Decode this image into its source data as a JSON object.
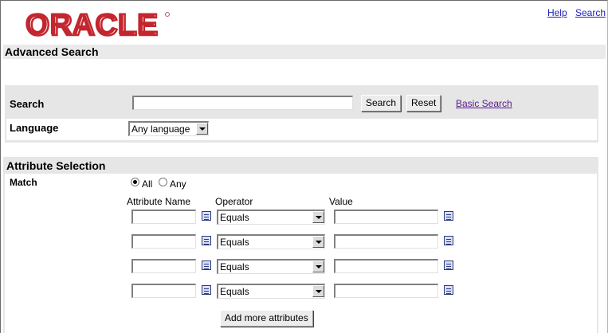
{
  "brand": {
    "logo_text": "ORACLE",
    "color": "#c4262e"
  },
  "top_links": {
    "help": "Help",
    "search": "Search"
  },
  "page_title": "Advanced Search",
  "search_panel": {
    "search_label": "Search",
    "search_value": "",
    "search_button": "Search",
    "reset_button": "Reset",
    "basic_search_link": "Basic Search",
    "language_label": "Language",
    "language_value": "Any language"
  },
  "attributes": {
    "title": "Attribute Selection",
    "match_label": "Match",
    "match_options": [
      {
        "label": "All",
        "selected": true
      },
      {
        "label": "Any",
        "selected": false
      }
    ],
    "columns": [
      "Attribute Name",
      "Operator",
      "Value"
    ],
    "rows": [
      {
        "name": "",
        "operator": "Equals",
        "value": ""
      },
      {
        "name": "",
        "operator": "Equals",
        "value": ""
      },
      {
        "name": "",
        "operator": "Equals",
        "value": ""
      },
      {
        "name": "",
        "operator": "Equals",
        "value": ""
      }
    ],
    "add_more_button": "Add more attributes"
  },
  "icons": {
    "lov": "list-of-values-icon",
    "dropdown": "chevron-down-icon",
    "radio": "radio-icon"
  }
}
